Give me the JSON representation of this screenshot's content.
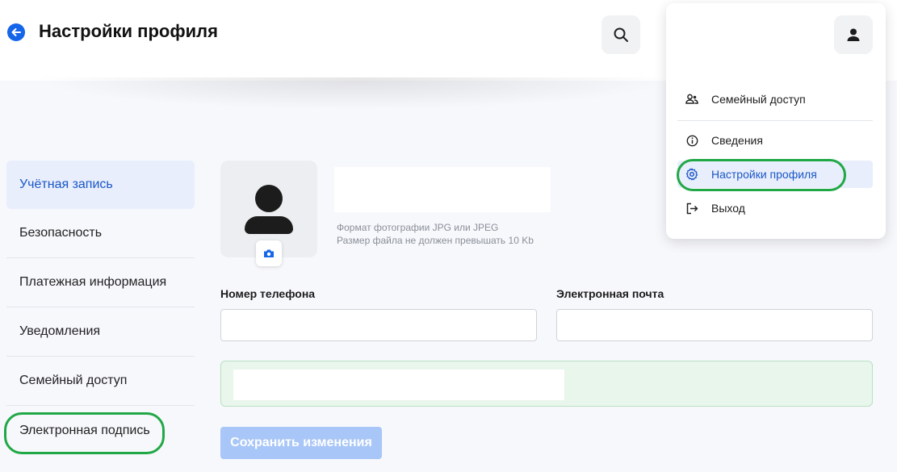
{
  "header": {
    "title": "Настройки профиля",
    "back_icon": "arrow-left-icon",
    "search_icon": "search-icon"
  },
  "sidebar": {
    "items": [
      {
        "label": "Учётная запись",
        "active": true
      },
      {
        "label": "Безопасность",
        "active": false
      },
      {
        "label": "Платежная информация",
        "active": false
      },
      {
        "label": "Уведомления",
        "active": false
      },
      {
        "label": "Семейный доступ",
        "active": false
      },
      {
        "label": "Электронная подпись",
        "active": false
      }
    ]
  },
  "avatar": {
    "photo_hint_line1": "Формат фотографии JPG или JPEG",
    "photo_hint_line2": "Размер файла не должен превышать 10 Kb",
    "camera_icon": "camera-icon"
  },
  "form": {
    "phone_label": "Номер телефона",
    "phone_value": "",
    "email_label": "Электронная почта",
    "email_value": "",
    "save_label": "Сохранить изменения"
  },
  "dropdown": {
    "profile_icon": "user-icon",
    "items": [
      {
        "label": "Семейный доступ",
        "icon": "family-icon"
      },
      {
        "label": "Сведения",
        "icon": "info-icon"
      },
      {
        "label": "Настройки профиля",
        "icon": "gear-icon",
        "active": true
      },
      {
        "label": "Выход",
        "icon": "logout-icon"
      }
    ]
  },
  "colors": {
    "accent": "#1565e9",
    "active_bg": "#e8eefb",
    "highlight": "#21a846",
    "save_disabled": "#a8c6f7"
  }
}
